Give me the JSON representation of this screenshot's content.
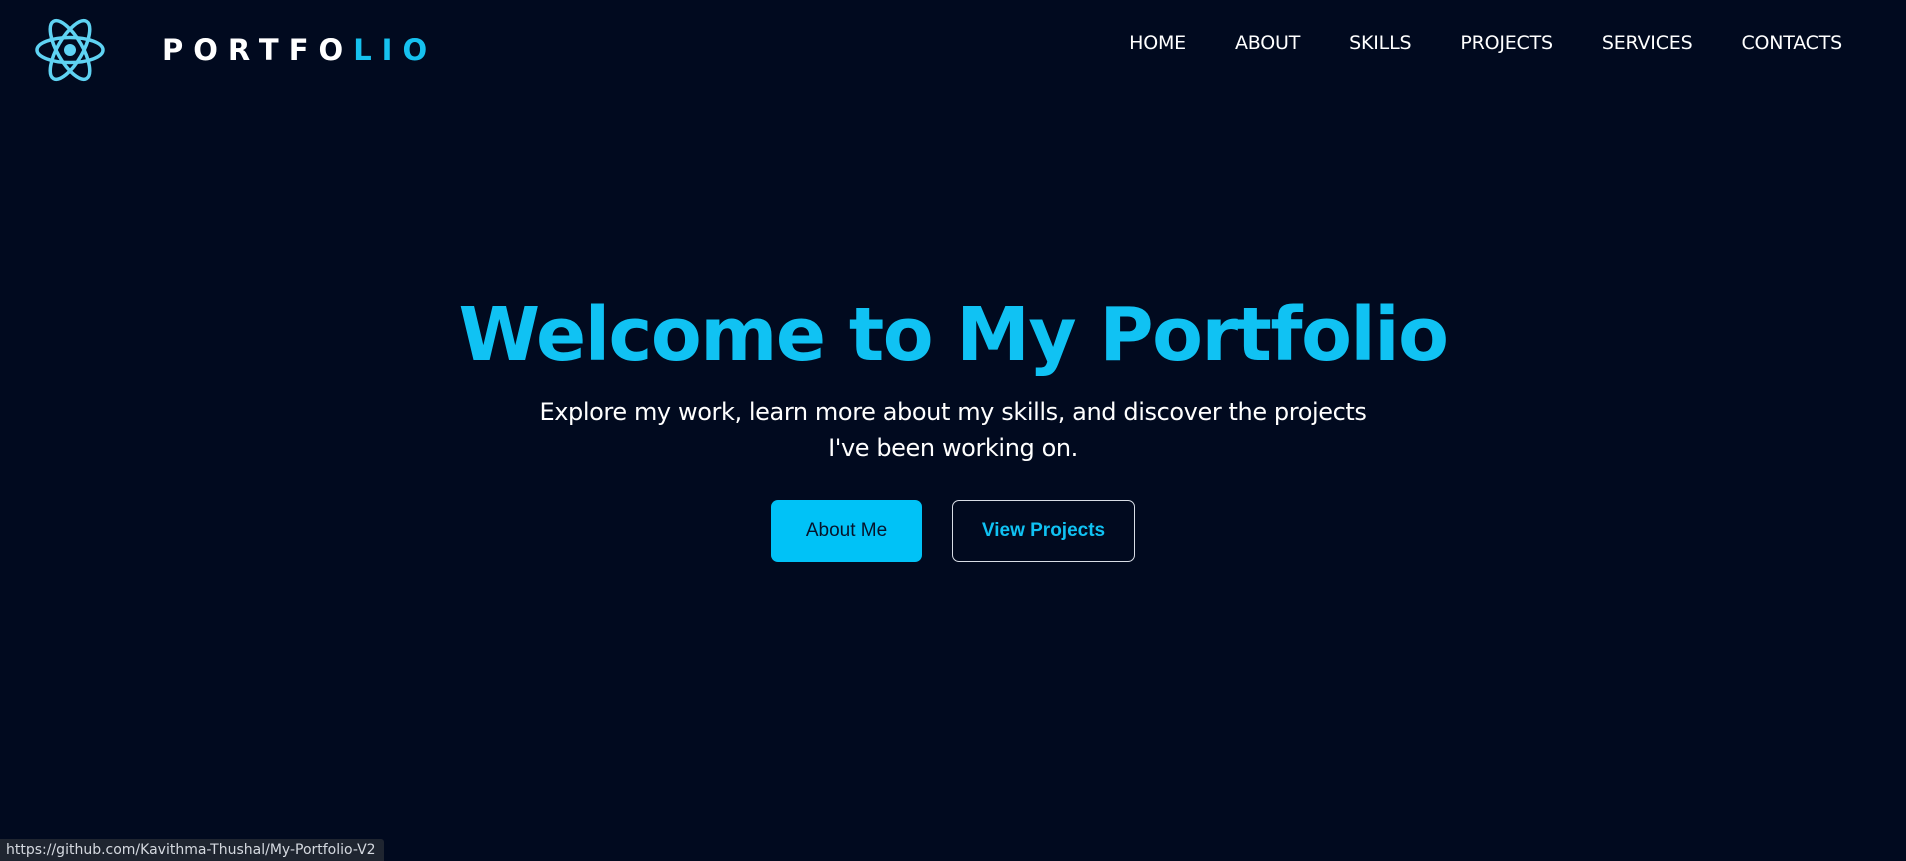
{
  "brand": {
    "text_main": "PORTFO",
    "text_accent": "LIO",
    "logo_icon": "atom-icon",
    "accent_color": "#16c1ef"
  },
  "nav": {
    "items": [
      {
        "label": "HOME"
      },
      {
        "label": "ABOUT"
      },
      {
        "label": "SKILLS"
      },
      {
        "label": "PROJECTS"
      },
      {
        "label": "SERVICES"
      },
      {
        "label": "CONTACTS"
      }
    ]
  },
  "hero": {
    "title": "Welcome to My Portfolio",
    "subtitle": "Explore my work, learn more about my skills, and discover the projects I've been working on.",
    "primary_button": "About Me",
    "secondary_button": "View Projects"
  },
  "status": {
    "url": "https://github.com/Kavithma-Thushal/My-Portfolio-V2"
  },
  "colors": {
    "background": "#010a1f",
    "accent": "#10c2f3",
    "button_fill": "#00c2f7"
  }
}
